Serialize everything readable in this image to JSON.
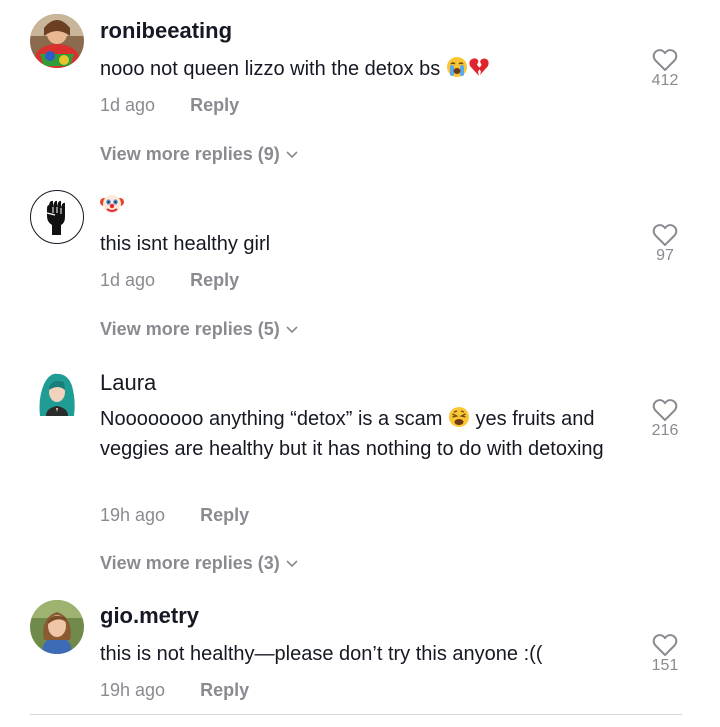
{
  "comments": [
    {
      "username": "ronibeeating",
      "text": "nooo not queen lizzo with the detox bs",
      "emoji_after": [
        "loudly-crying-face",
        "broken-heart"
      ],
      "time": "1d ago",
      "reply_label": "Reply",
      "likes": "412",
      "view_more": "View more replies (9)"
    },
    {
      "username": "",
      "username_emoji": "clown-face",
      "text": "this isnt healthy girl",
      "time": "1d ago",
      "reply_label": "Reply",
      "likes": "97",
      "view_more": "View more replies (5)"
    },
    {
      "username": "Laura",
      "text_part1": "Noooooooo anything “detox” is a scam",
      "text_emoji": "weary-face",
      "text_part2": " yes fruits and veggies are healthy but it has nothing to do with detoxing",
      "time": "19h ago",
      "reply_label": "Reply",
      "likes": "216",
      "view_more": "View more replies (3)"
    },
    {
      "username": "gio.metry",
      "text": "this is not healthy—please don’t try this anyone :((",
      "time": "19h ago",
      "reply_label": "Reply",
      "likes": "151"
    }
  ],
  "colors": {
    "primary_text": "#161823",
    "secondary_text": "#8a8b91",
    "divider": "#d8d8da"
  }
}
